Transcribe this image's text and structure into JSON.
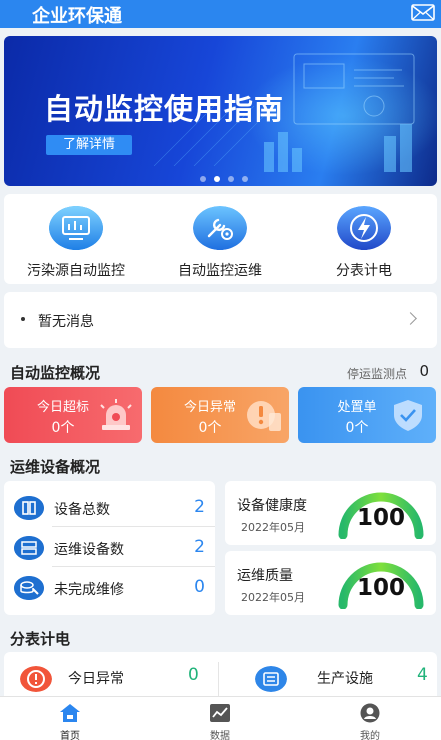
{
  "header": {
    "title": "企业环保通",
    "mail_icon": "mail-icon"
  },
  "banner": {
    "title": "自动监控使用指南",
    "button_label": "了解详情",
    "page_count": 4,
    "active_page": 2
  },
  "quick_actions": [
    {
      "label": "污染源自动监控",
      "icon": "monitor-screen-icon",
      "color": "#2e9ff0"
    },
    {
      "label": "自动监控运维",
      "icon": "wrench-gear-icon",
      "color": "#2e86e8"
    },
    {
      "label": "分表计电",
      "icon": "lightning-icon",
      "color": "#2d63d8"
    }
  ],
  "notice": {
    "text": "暂无消息",
    "chevron": "chevron-right-icon"
  },
  "monitor_overview": {
    "title": "自动监控概况",
    "stopped_label": "停运监测点",
    "stopped_value": "0",
    "cards": [
      {
        "title": "今日超标",
        "value": "0个",
        "icon": "alarm-light-icon",
        "color": "#f2545b"
      },
      {
        "title": "今日异常",
        "value": "0个",
        "icon": "warning-badge-icon",
        "color": "#f6914a"
      },
      {
        "title": "处置单",
        "value": "0个",
        "icon": "shield-check-icon",
        "color": "#3f99f1"
      }
    ]
  },
  "device_overview": {
    "title": "运维设备概况",
    "rows": [
      {
        "label": "设备总数",
        "value": "2",
        "icon": "server-icon"
      },
      {
        "label": "运维设备数",
        "value": "2",
        "icon": "device-rack-icon"
      },
      {
        "label": "未完成维修",
        "value": "0",
        "icon": "repair-icon"
      }
    ],
    "gauges": [
      {
        "title": "设备健康度",
        "date": "2022年05月",
        "value": "100",
        "level": 1.0
      },
      {
        "title": "运维质量",
        "date": "2022年05月",
        "value": "100",
        "level": 1.0
      }
    ]
  },
  "meter": {
    "title": "分表计电",
    "items": [
      {
        "label": "今日异常",
        "value": "0",
        "icon": "alert-circle-icon",
        "color": "#f1553a"
      },
      {
        "label": "生产设施",
        "value": "4",
        "icon": "factory-list-icon",
        "color": "#2e86e8"
      }
    ]
  },
  "tabbar": {
    "tabs": [
      {
        "label": "首页",
        "icon": "home-icon",
        "active": true
      },
      {
        "label": "数据",
        "icon": "chart-icon",
        "active": false
      },
      {
        "label": "我的",
        "icon": "user-icon",
        "active": false
      }
    ]
  },
  "colors": {
    "primary": "#2b86ef",
    "success": "#21b37a",
    "danger": "#f2545b",
    "warning": "#f6914a"
  }
}
